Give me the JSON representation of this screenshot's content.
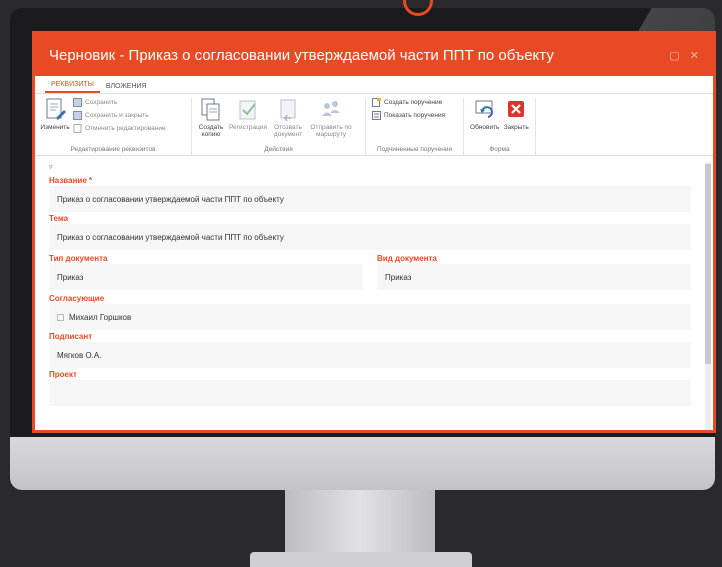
{
  "window": {
    "title": "Черновик - Приказ о согласовании утверждаемой части ППТ по объекту"
  },
  "tabs": [
    {
      "label": "РЕКВИЗИТЫ",
      "active": true
    },
    {
      "label": "ВЛОЖЕНИЯ",
      "active": false
    }
  ],
  "ribbon": {
    "edit_group": {
      "label": "Редактирование реквизитов",
      "change": "Изменить",
      "save": "Сохранить",
      "save_close": "Сохранить и закрыть",
      "cancel_edit": "Отменить редактирование"
    },
    "actions_group": {
      "label": "Действия",
      "create_copy_1": "Создать",
      "create_copy_2": "копию",
      "register": "Регистрация",
      "recall_1": "Отозвать",
      "recall_2": "документ",
      "send_1": "Отправить по",
      "send_2": "маршруту"
    },
    "sub_group": {
      "label": "Подчиненные поручения",
      "create_task": "Создать поручение",
      "show_tasks": "Показать поручения"
    },
    "form_group": {
      "label": "Форма",
      "refresh": "Обновить",
      "close": "Закрыть"
    }
  },
  "form": {
    "name_label": "Название *",
    "name_value": "Приказ о согласовании утверждаемой части ППТ по объекту",
    "topic_label": "Тема",
    "topic_value": "Приказ о согласовании утверждаемой части ППТ по объекту",
    "doc_type_label": "Тип документа",
    "doc_type_value": "Приказ",
    "doc_kind_label": "Вид документа",
    "doc_kind_value": "Приказ",
    "approvers_label": "Согласующие",
    "approver_1": "Михаил Горшков",
    "signer_label": "Подписант",
    "signer_value": "Мягков О.А.",
    "project_label": "Проект"
  },
  "colors": {
    "accent": "#e84a25"
  }
}
